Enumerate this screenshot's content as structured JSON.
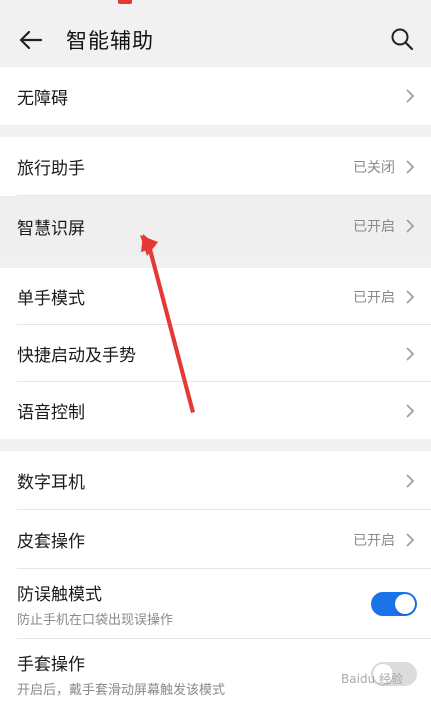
{
  "header": {
    "title": "智能辅助",
    "back_icon": "back-arrow-icon",
    "search_icon": "search-icon"
  },
  "groups": {
    "g1": {
      "accessibility": {
        "label": "无障碍"
      }
    },
    "g2": {
      "travel": {
        "label": "旅行助手",
        "status": "已关闭"
      },
      "smart_screen": {
        "label": "智慧识屏",
        "status": "已开启"
      },
      "one_hand": {
        "label": "单手模式",
        "status": "已开启"
      },
      "shortcuts": {
        "label": "快捷启动及手势"
      },
      "voice": {
        "label": "语音控制"
      }
    },
    "g3": {
      "earphone": {
        "label": "数字耳机"
      },
      "cover": {
        "label": "皮套操作",
        "status": "已开启"
      },
      "accidental": {
        "label": "防误触模式",
        "sub": "防止手机在口袋出现误操作",
        "toggle": true
      },
      "glove": {
        "label": "手套操作",
        "sub": "开启后，戴手套滑动屏幕触发该模式",
        "toggle": false
      }
    }
  },
  "colors": {
    "toggle_on": "#1a73e8",
    "annotation_arrow": "#e53935"
  },
  "watermark": "Baidu 经验"
}
